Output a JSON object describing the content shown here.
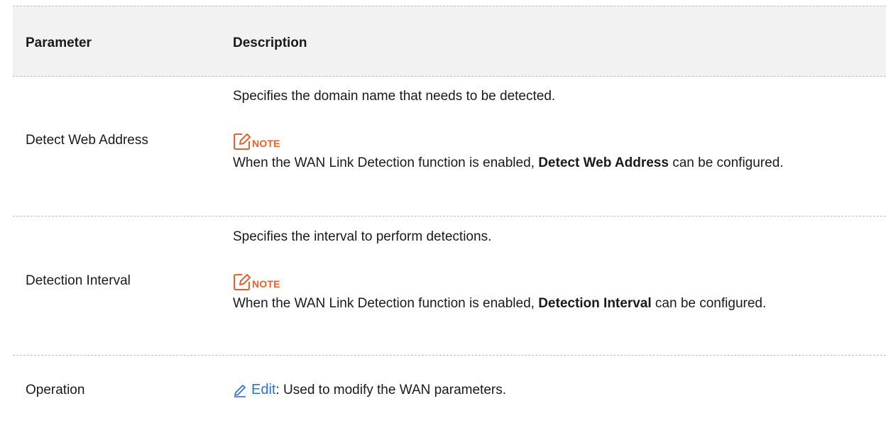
{
  "header": {
    "parameter": "Parameter",
    "description": "Description"
  },
  "rows": [
    {
      "parameter": "Detect Web Address",
      "description": "Specifies the domain name that needs to be detected.",
      "note_label": "NOTE",
      "note_prefix": "When the WAN Link Detection function is enabled, ",
      "note_bold": "Detect Web Address",
      "note_suffix": " can be configured."
    },
    {
      "parameter": "Detection Interval",
      "description": "Specifies the interval to perform detections.",
      "note_label": "NOTE",
      "note_prefix": "When the WAN Link Detection function is enabled, ",
      "note_bold": "Detection Interval",
      "note_suffix": " can be configured."
    },
    {
      "parameter": "Operation",
      "edit_label": "Edit",
      "description": ": Used to modify the WAN parameters."
    }
  ],
  "colors": {
    "note": "#e8612c",
    "edit": "#2b6fd6",
    "header_bg": "#f2f2f2"
  },
  "icons": {
    "note": "note-pencil-icon",
    "edit": "pencil-icon"
  }
}
